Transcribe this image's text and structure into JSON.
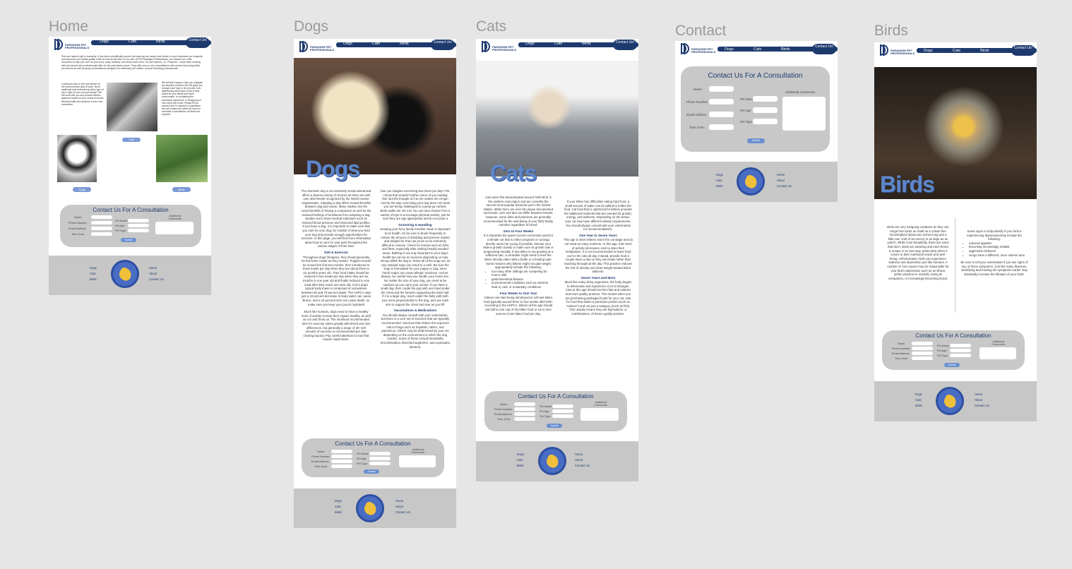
{
  "frames": {
    "home": {
      "label": "Home"
    },
    "dogs": {
      "label": "Dogs"
    },
    "cats": {
      "label": "Cats"
    },
    "contact": {
      "label": "Contact"
    },
    "birds": {
      "label": "Birds"
    }
  },
  "nav": {
    "dogs": "Dogs",
    "cats": "Cats",
    "birds": "Birds",
    "contact": "Contact Us!",
    "logo_line1": "PARADIGM PET",
    "logo_line2": "PROFESSIONALS"
  },
  "home": {
    "intro": "Pets are nature's gift to humanity. It has been scientifically proven that opening our homes and hearts to a pet increases our longevity and improves our overall quality of life as well as the lives of our pets. At Pet Paradigm Professionals, our mission is to offer resources to help you care for your furry, scaly, feathery, and slimy loved ones. Our pet experts—or \"Pexperts\"—have been working with pet owners and professionals alike for the past twelve years. They offer one-on-one consultations with current and prospective pet owners as well as group presentations designed for veterinary, pet shelter, and pet breeding professionals.",
    "left_text": "Looking for tips on pet care advice for the most common type of pets? Need additional help determining which type of pet is right for you and your family? We will work with you and provide tailored guidance based on your needs to ensure lifelong health and wellness of your new companion.",
    "right_text": "We will also happy to help you navigate the adoption process! We will guide you through each step in the process from determining which type of pet is best suited for your family and home environment, to completing the necessary paperwork. In bringing your new loved one home. Please fill out contact form to request a consultation. We will contact you within 48 hours to schedule a consultation. All fields are required.",
    "cats_btn": "Cats",
    "dogs_btn": "Dogs",
    "birds_btn": "Birds"
  },
  "form": {
    "title": "Contact Us For A Consultation",
    "name": "Name:",
    "phone": "Phone Number:",
    "email": "Email Address:",
    "time": "Time Zone:",
    "pet_name": "Pet Name:",
    "pet_age": "Pet Age:",
    "pet_type": "Pet Type:",
    "comments": "Additional Comments:",
    "submit": "Submit"
  },
  "footer": {
    "dogs": "Dogs",
    "cats": "Cats",
    "birds": "Birds",
    "home": "Home",
    "about": "About",
    "contact": "Contact Us"
  },
  "dogs": {
    "hero_title": "Dogs",
    "col1_p1": "The domestic dog is an extremely social animal and offers a diverse variety of choices as there are well over 300 breeds recognized by the World Canine Organization. Adopting a dog offers mutual benefits between dog and owner. Many studies cite the social benefits of having a companion as well as the reduced feelings of loneliness from adopting a dog. Studies even show medical indicators such as reduced blood pressure and improved lipid profiles. If you have a dog, it is important to make sure that you care for your dog; be mindful of what you feed your dog and provide enough opportunities for exercise. In this page, you will find more information about how to care for your pets throughout the various stages of their lives.",
    "h_diet": "Diet & Exercise",
    "col1_p2": "Throughout dogs' lifespans, they should generally be fed fewer meals as they mature. Puppies should be nursed the first two months, then introduced to three meals per day when they are about three to six months years old. Their food intake should be reduced to two meals per day when they are six months to one year old and finally reduced to one meal after they reach one year old. And a dog's typical body mass is composed of somewhere between 60 and 70 percent water. The ASPCA says just a 10 percent decrease in body water can cause illness, and a 15 percent loss can cause death, so make sure you keep your pooch hydrated!",
    "col1_p3": "Much like humans, dogs need to have a healthy level of activity to keep their organs healthy, as well as run and fresh air. The minimum recommended time for exercise varies greatly with breed and size differences, but generally a range of 30–120 minutes of exercise is recommended per day! choking hazard. Pay careful attention to toys that require supervision.",
    "col2_p1": "Can you imagine exercising two hours per day? OK, I know that wouldn't bother some of you reading this. But the thought of it to me makes me cringe! And by the way, exercising your dog does not mean you are being challenged to a jump-up contest. Brisk walks are OK too! You can also choose from a variety of toys to encourage physical activity; just be sure they are age appropriate and do not pose a",
    "h_groom": "Grooming & Handling",
    "col2_p2": "Keeping your furry family member clean is important to its health. So be sure to brush frequently to reduce the amount of shedding and prevent matted and tangled fur that can prove to be extremely difficult to remove. Check for insects such as ticks and fleas, especially after visiting heavily wooded areas. Bathing is not only important to your dog's health but can be an exercise depending on how strong willed the dog is. Rinse all of the soap out, as any residual soap can result in a rash. Be sure the soap is formulated for your puppy or dog, since harsh soaps can cause allergic reactions. And as always, be careful how you handle your loved one. No matter the size of your dog, you need to be cautious as you carry your canine. If you have a small dog, then cradle the pup with one hand under the chest and the forearm supporting the back half. If it is a large dog, reach under the belly with both your arms perpendicular to the dog, and use each arm to support the chest and rear as you lift.",
    "h_vacc": "Vaccinations & Medications",
    "col2_p3": "You should always consult with your veterinarian, but there is a core set of vaccines that are typically recommended. Vaccines that reduce the exposure risk to things such as hepatitis, rabies, and parvovirus. Others may be determined by your vet depending on the environment in which the dog resides. Some of these include Bordetella bronchiseptica, Borrelia burgdorferi, and Leptospira bacteria."
  },
  "cats": {
    "hero_title": "Cats",
    "col1_p1": "Cats were first domesticated around 7500 BCE in the western Asia region and are currently the second most popular domestic pet in the United States. While there are over 60 unique documented cat breeds, care and diet can differ between breeds. However, some diets and practices are generally recommended for the well-being of your fluffy family member regardless of breed.",
    "h_zero": "Zero to Four Weeks",
    "col1_p2": "It is important the queen (a term commonly used for a female cat that is either pregnant or nursing) directly nurse her young if possible. Monitor your kittens growth closely to make sure its growth rate is progressing steadily. If any kitten is not growing at a sufficient rate, a caretaker might need to feed the kitten directly either with a bottle or a feeding tube. Some reasons why kittens might not gain weight appropriately include the following:",
    "bullets": [
      "too many other siblings are competing for mom's milk",
      "gastrointestinal disease",
      "environmental conditions such as extreme heat or cold, or unsanitary conditions"
    ],
    "h_four": "Four Weeks to One Year",
    "col1_p3": "Kittens can start being introduced to soft wet kitten food typically around three to four weeks after birth. According to the ASPCA, kittens at this age should eat half to one cup of dry kitten food or six to nine ounces of wet kitten food per day.",
    "col2_p1": "If your kitten has difficulties eating hard food, a small amount of water can be added to soften the food. Cat food that is optimized for kittens provides the additional nutrients that are needed for growth, energy, and wellness. Depending on the breed, your cat may have different dietary requirements. You should always consult with your veterinarian for recommendations.",
    "h_one": "One Year to Seven Years",
    "col2_p2": "This age is when kittens reach the cat stage and do not need as many nutrients. At this age, their level of activity decreases, and so does their metabolism. It is not recommended to leave food out for the cats all day. Instead, provide food a couple times a day so they eat meals rather than snacking throughout the day. This practice reduces the risk of obesity and other weight-related feline ailments.",
    "h_seven": "Seven Years and More",
    "col2_p3": "Much like many living organisms, the body begins to deteriorate and experience a lot of changes. Cats at this age should eat less fats and calories and more quality proteins. This means when you are purchasing packaged foods for your cat, look for food that states a particular protein (such as \"salmon\") and not just a category (such as fish). This usually means they are byproducts, or combinations, of lesser quality proteins."
  },
  "birds": {
    "hero_title": "Birds",
    "col1": "Birds are very intriguing creatures as they can range from birds as small as a Cuban bee hummingbird (about two inches long and a little over 1/20 of an ounce) to as large as an ostrich. While most beautifully, there are some that don't. Birds are amazing and each breed is unique in its own way, particularly when it comes to their nutritional needs and well-being. Unfortunately, birds can experience sadness and depression just like humans. A number of root causes may be responsible for your bird's depression such as an illness (either physical or mental), losing its companion, or increasingly becoming bored.",
    "col2_intro": "Some signs to help identify if your bird is experiencing depression/may include the following:",
    "signs": [
      "reduced appetite",
      "becoming increasingly irritable",
      "aggressive behavior",
      "songs have a different, more solemn tone"
    ],
    "col2_end": "Be sure to tell your veterinarian if you see signs of any of these symptoms. Just like many illnesses, identifying and treating the symptoms earlier may drastically increase the lifespan of your birds."
  }
}
